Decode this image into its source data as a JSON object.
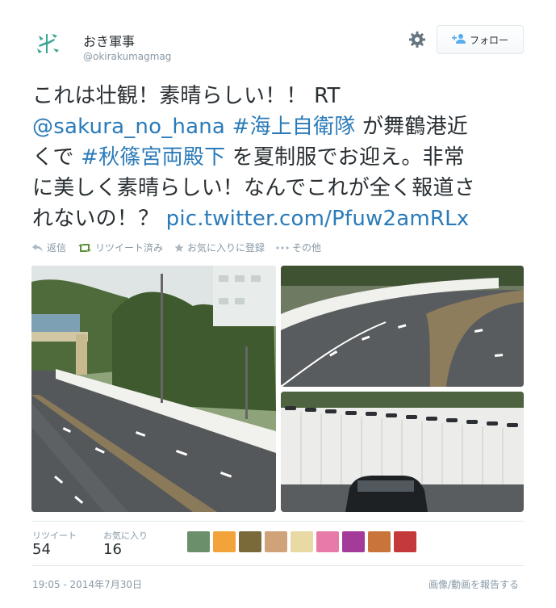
{
  "user": {
    "display_name": "おき軍事",
    "screen_name": "@okirakumagmag"
  },
  "header": {
    "follow_label": "フォロー"
  },
  "tweet": {
    "line1": "これは壮観！素晴らしい！！ RT",
    "mention": "@sakura_no_hana",
    "hashtag1": "#海上自衛隊",
    "text2": " が舞鶴港近",
    "text3": "くで ",
    "hashtag2": "#秋篠宮両殿下",
    "text4": " を夏制服でお迎え。非常",
    "text5": "に美しく素晴らしい！なんでこれが全く報道さ",
    "text6": "れないの！？ ",
    "pic_link": "pic.twitter.com/Pfuw2amRLx"
  },
  "actions": {
    "reply": "返信",
    "retweet": "リツイート済み",
    "favorite": "お気に入りに登録",
    "more": "その他"
  },
  "stats": {
    "retweets_label": "リツイート",
    "retweets_count": "54",
    "favorites_label": "お気に入り",
    "favorites_count": "16"
  },
  "footer": {
    "timestamp": "19:05 - 2014年7月30日",
    "report": "画像/動画を報告する"
  },
  "colors": {
    "link": "#2b7bb9",
    "muted": "#8899a6",
    "text": "#292f33",
    "border": "#e1e8ed"
  }
}
